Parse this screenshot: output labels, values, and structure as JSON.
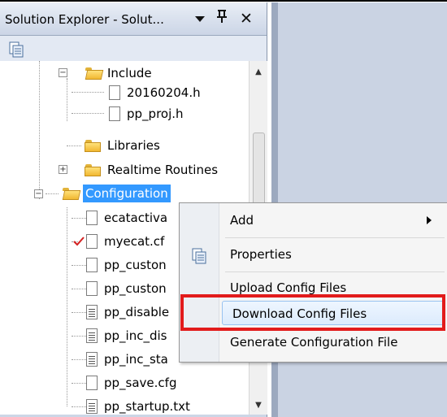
{
  "panel": {
    "title": "Solution Explorer - Solut...",
    "pin_glyph": "⭿",
    "close_glyph": "✕"
  },
  "tree": {
    "items": [
      {
        "label": "Include",
        "icon": "folder-open-icon"
      },
      {
        "label": "20160204.h",
        "icon": "file-icon"
      },
      {
        "label": "pp_proj.h",
        "icon": "file-icon"
      },
      {
        "label": "Libraries",
        "icon": "folder-icon"
      },
      {
        "label": "Realtime Routines",
        "icon": "folder-icon"
      },
      {
        "label": "Configuration",
        "icon": "folder-open-icon",
        "selected": true
      },
      {
        "label": "ecatactiva",
        "icon": "file-icon"
      },
      {
        "label": "myecat.cf",
        "icon": "file-icon"
      },
      {
        "label": "pp_custon",
        "icon": "file-icon"
      },
      {
        "label": "pp_custon",
        "icon": "file-icon"
      },
      {
        "label": "pp_disable",
        "icon": "text-file-icon"
      },
      {
        "label": "pp_inc_dis",
        "icon": "text-file-icon"
      },
      {
        "label": "pp_inc_sta",
        "icon": "text-file-icon"
      },
      {
        "label": "pp_save.cfg",
        "icon": "file-icon"
      },
      {
        "label": "pp_startup.txt",
        "icon": "text-file-icon"
      }
    ]
  },
  "context_menu": {
    "items": [
      {
        "label": "Add",
        "has_submenu": true
      },
      {
        "label": "Properties"
      },
      {
        "label": "Upload Config Files"
      },
      {
        "label": "Download Config Files",
        "hovered": true
      },
      {
        "label": "Generate Configuration File"
      }
    ]
  },
  "colors": {
    "selection": "#3399ff",
    "highlight_border": "#e21b1b",
    "panel_bg": "#ccd6e6"
  }
}
